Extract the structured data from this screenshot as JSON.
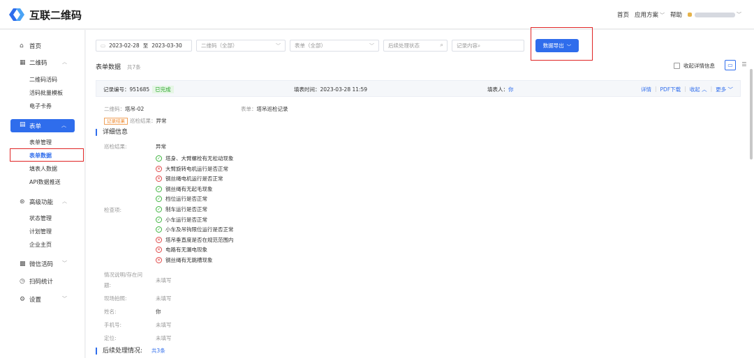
{
  "header": {
    "logo_text": "互联二维码",
    "nav": [
      "首页",
      "应用方案",
      "帮助"
    ]
  },
  "sidebar": {
    "home": "首页",
    "qrcode": "二维码",
    "qrcode_items": [
      "二维码活码",
      "活码批量模板",
      "电子卡券"
    ],
    "form": "表单",
    "form_items": [
      "表单管理",
      "表单数据",
      "填表人数据",
      "API数据推送"
    ],
    "advanced": "高级功能",
    "advanced_items": [
      "状态管理",
      "计划管理",
      "企业主页"
    ],
    "wechat": "微信活码",
    "stats": "扫码统计",
    "settings": "设置"
  },
  "filters": {
    "date_start": "2023-02-28",
    "date_sep": "至",
    "date_end": "2023-03-30",
    "qrcode_select": "二维码（全部）",
    "form_select": "表单（全部）",
    "status_placeholder": "后续处理状态",
    "content_placeholder": "记录内容",
    "export_label": "数据导出"
  },
  "section": {
    "title": "表单数据",
    "count": "共7条",
    "collapse_label": "收起详情信息"
  },
  "record": {
    "id_label": "记录编号：951685",
    "status": "已完成",
    "time": "填表时间：2023-03-28 11:59",
    "filler_label": "填表人：",
    "filler_value": "你",
    "actions": [
      "详情",
      "PDF下载",
      "收起",
      "更多"
    ]
  },
  "summary": {
    "qrcode_label": "二维码：",
    "qrcode_value": "塔吊-02",
    "form_label": "表单：",
    "form_value": "塔吊巡检记录",
    "result_tag": "记录结果",
    "result_label": "巡检结果：",
    "result_value": "异常"
  },
  "detail": {
    "title": "详细信息",
    "result_label": "巡检结果:",
    "result_value": "异常",
    "check_label": "检查项:",
    "check_items": [
      {
        "text": "塔身、大臂螺栓有无松动现象",
        "ok": true
      },
      {
        "text": "大臂旋转电机运行是否正常",
        "ok": false
      },
      {
        "text": "钢丝绳电机运行是否正常",
        "ok": false
      },
      {
        "text": "钢丝绳有无起毛现象",
        "ok": true
      },
      {
        "text": "档位运行是否正常",
        "ok": true
      },
      {
        "text": "制车运行是否正常",
        "ok": true
      },
      {
        "text": "小车运行是否正常",
        "ok": true
      },
      {
        "text": "小车及吊钩限位运行是否正常",
        "ok": true
      },
      {
        "text": "塔吊垂直度是否在规范范围内",
        "ok": false
      },
      {
        "text": "电路有无漏电现象",
        "ok": false
      },
      {
        "text": "钢丝绳有无跳槽现象",
        "ok": false
      }
    ],
    "note_label_1": "情况说明/存在问",
    "note_label_2": "题:",
    "note_value": "未填写",
    "photo_label": "现场拍照:",
    "photo_value": "未填写",
    "name_label": "姓名:",
    "name_value": "你",
    "phone_label": "手机号:",
    "phone_value": "未填写",
    "location_label": "定位:",
    "location_value": "未填写",
    "followup_title": "后续处理情况:",
    "followup_count": "共3条"
  },
  "colors": {
    "primary": "#2f6dec",
    "highlight": "#e02424",
    "ok": "#3fb53f",
    "bad": "#e04848"
  }
}
